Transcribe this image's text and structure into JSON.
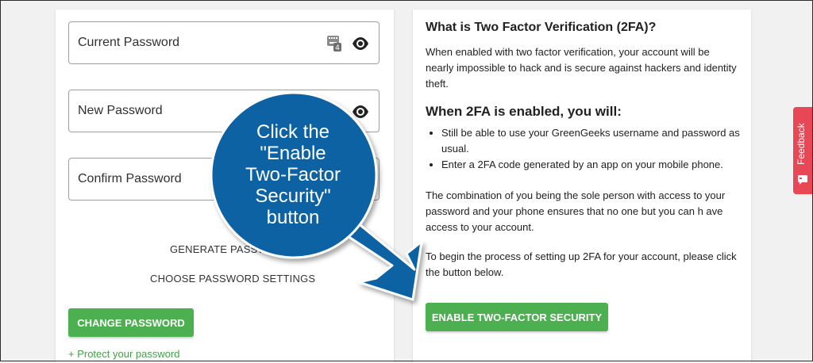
{
  "password_form": {
    "current_password_label": "Current Password",
    "new_password_label": "New Password",
    "confirm_password_label": "Confirm Password",
    "generate_password": "GENERATE PASSWORD",
    "choose_settings": "CHOOSE PASSWORD SETTINGS",
    "change_password_button": "CHANGE PASSWORD",
    "protect_link": "+ Protect your password"
  },
  "twofa": {
    "title": "What is Two Factor Verification (2FA)?",
    "intro": "When enabled with two factor verification, your account will be nearly impossible to hack and is secure against hackers and identity theft.",
    "subhead": "When 2FA is enabled, you will:",
    "bullets": [
      "Still be able to use your GreenGeeks username and password as usual.",
      "Enter a 2FA code generated by an app on your mobile phone."
    ],
    "paragraph2": "The combination of you being the sole person with access to your password and your phone ensures that no one but you can h ave access to your account.",
    "paragraph3": "To begin the process of setting up 2FA for your account, please click the button below.",
    "enable_button": "ENABLE TWO-FACTOR SECURITY"
  },
  "feedback_tab": {
    "label": "Feedback"
  },
  "callout": {
    "text": "Click the\n\"Enable\nTwo-Factor\nSecurity\"\nbutton"
  },
  "icons": [
    "eye-icon",
    "keyboard-icon",
    "feedback-icon"
  ],
  "colors": {
    "green": "#4caf50",
    "callout_blue": "#0b62a4",
    "feedback_red": "#e84855"
  }
}
